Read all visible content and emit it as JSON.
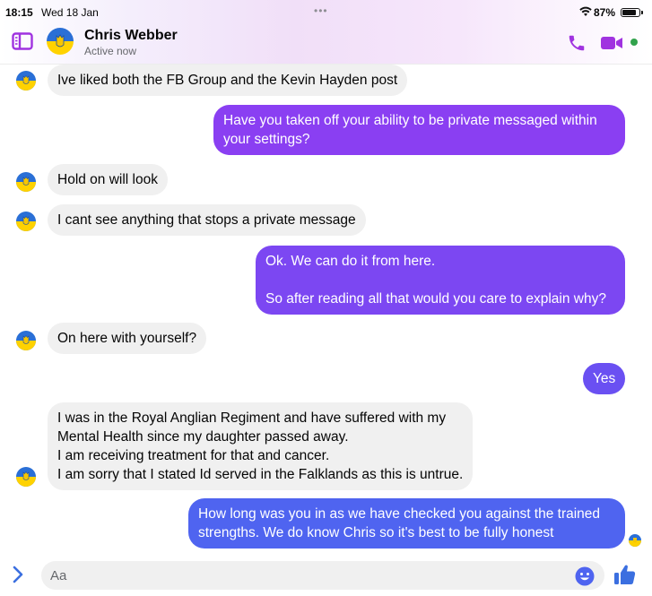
{
  "status_bar": {
    "time": "18:15",
    "date": "Wed 18 Jan",
    "dots": "•••",
    "battery": "87%"
  },
  "header": {
    "name": "Chris Webber",
    "status": "Active now"
  },
  "messages": [
    {
      "side": "in",
      "text": "Ive liked both the FB Group and the Kevin Hayden post"
    },
    {
      "side": "out",
      "text": "Have you taken off your ability to be private messaged within your settings?"
    },
    {
      "side": "in",
      "text": "Hold on will look"
    },
    {
      "side": "in",
      "text": "I cant see anything that stops a private message"
    },
    {
      "side": "out",
      "text": "Ok. We can do it from here.\n\nSo after reading all that would you care to explain why?"
    },
    {
      "side": "in",
      "text": "On here with yourself?"
    },
    {
      "side": "out",
      "text": "Yes"
    },
    {
      "side": "in",
      "text": "I was in the Royal Anglian Regiment and have suffered with my\nMental Health since my daughter passed away.\nI am receiving treatment for that and cancer.\nI am sorry that I stated Id served in the Falklands as this is untrue."
    },
    {
      "side": "out",
      "text": "How long was you in as we have checked you against the trained\nstrengths. We do know Chris so it's best to be fully honest"
    }
  ],
  "composer": {
    "placeholder": "Aa"
  },
  "colors": {
    "bubble_purple": "#8a3ff2",
    "bubble_blue": "#4f64f0",
    "accent": "#a033e0",
    "bubble_in": "#f0f0f0"
  },
  "icons": [
    "wifi-icon",
    "battery-icon",
    "sidebar-toggle-icon",
    "phone-icon",
    "video-icon",
    "chevron-right-icon",
    "emoji-icon",
    "thumbs-up-icon",
    "ukraine-avatar"
  ]
}
